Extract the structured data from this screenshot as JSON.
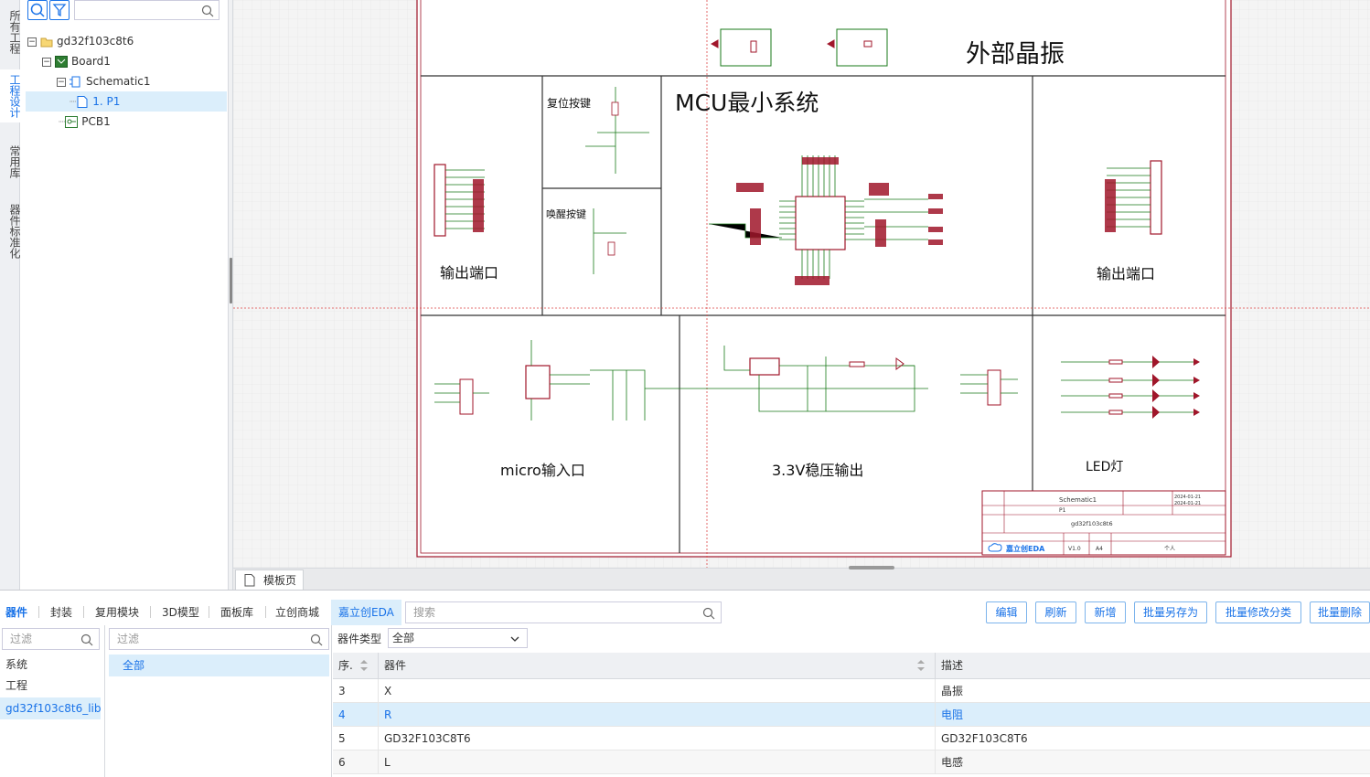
{
  "left_tabs": [
    {
      "label": "所有工程",
      "active": false
    },
    {
      "label": "工程设计",
      "active": true
    },
    {
      "label": "常用库",
      "active": false
    },
    {
      "label": "器件标准化",
      "active": false
    }
  ],
  "project_tree": {
    "search_placeholder": "",
    "items": [
      {
        "label": "gd32f103c8t6",
        "icon": "folder-icon"
      },
      {
        "label": "Board1",
        "icon": "board-icon"
      },
      {
        "label": "Schematic1",
        "icon": "schematic-icon"
      },
      {
        "label": "1. P1",
        "icon": "page-icon"
      },
      {
        "label": "PCB1",
        "icon": "pcb-icon"
      }
    ]
  },
  "schematic": {
    "blocks": {
      "crystal": "外部晶振",
      "mcu": "MCU最小系统",
      "reset": "复位按键",
      "wakeup": "唤醒按键",
      "out_left": "输出端口",
      "out_right": "输出端口",
      "micro": "micro输入口",
      "ldo": "3.3V稳压输出",
      "led": "LED灯"
    },
    "title_block": {
      "sheet": "Schematic1",
      "page": "P1",
      "project": "gd32f103c8t6",
      "version": "V1.0",
      "size": "A4",
      "owner": "个人",
      "date1": "2024-01-21",
      "date2": "2024-01-21",
      "logo": "嘉立创EDA"
    }
  },
  "page_tab": {
    "label": "模板页"
  },
  "bottom": {
    "tabs": [
      "器件",
      "封装",
      "复用模块",
      "3D模型",
      "面板库",
      "立创商城",
      "嘉立创EDA"
    ],
    "search_placeholder": "搜索",
    "actions": [
      "编辑",
      "刷新",
      "新增",
      "批量另存为",
      "批量修改分类",
      "批量删除"
    ],
    "lib_filter_placeholder": "过滤",
    "cat_filter_placeholder": "过滤",
    "libraries": [
      "系统",
      "工程",
      "gd32f103c8t6_lib"
    ],
    "selected_library": "gd32f103c8t6_lib",
    "categories": [
      "全部"
    ],
    "type_label": "器件类型",
    "type_value": "全部",
    "columns": [
      "序.",
      "器件",
      "描述"
    ],
    "rows": [
      {
        "no": "3",
        "name": "X",
        "desc": "晶振"
      },
      {
        "no": "4",
        "name": "R",
        "desc": "电阻"
      },
      {
        "no": "5",
        "name": "GD32F103C8T6",
        "desc": "GD32F103C8T6"
      },
      {
        "no": "6",
        "name": "L",
        "desc": "电感"
      }
    ],
    "selected_row": 1
  },
  "colors": {
    "accent": "#1a73e8",
    "frame": "#a0162a",
    "wire": "#1a7a1a",
    "selection": "#dbeefb"
  }
}
